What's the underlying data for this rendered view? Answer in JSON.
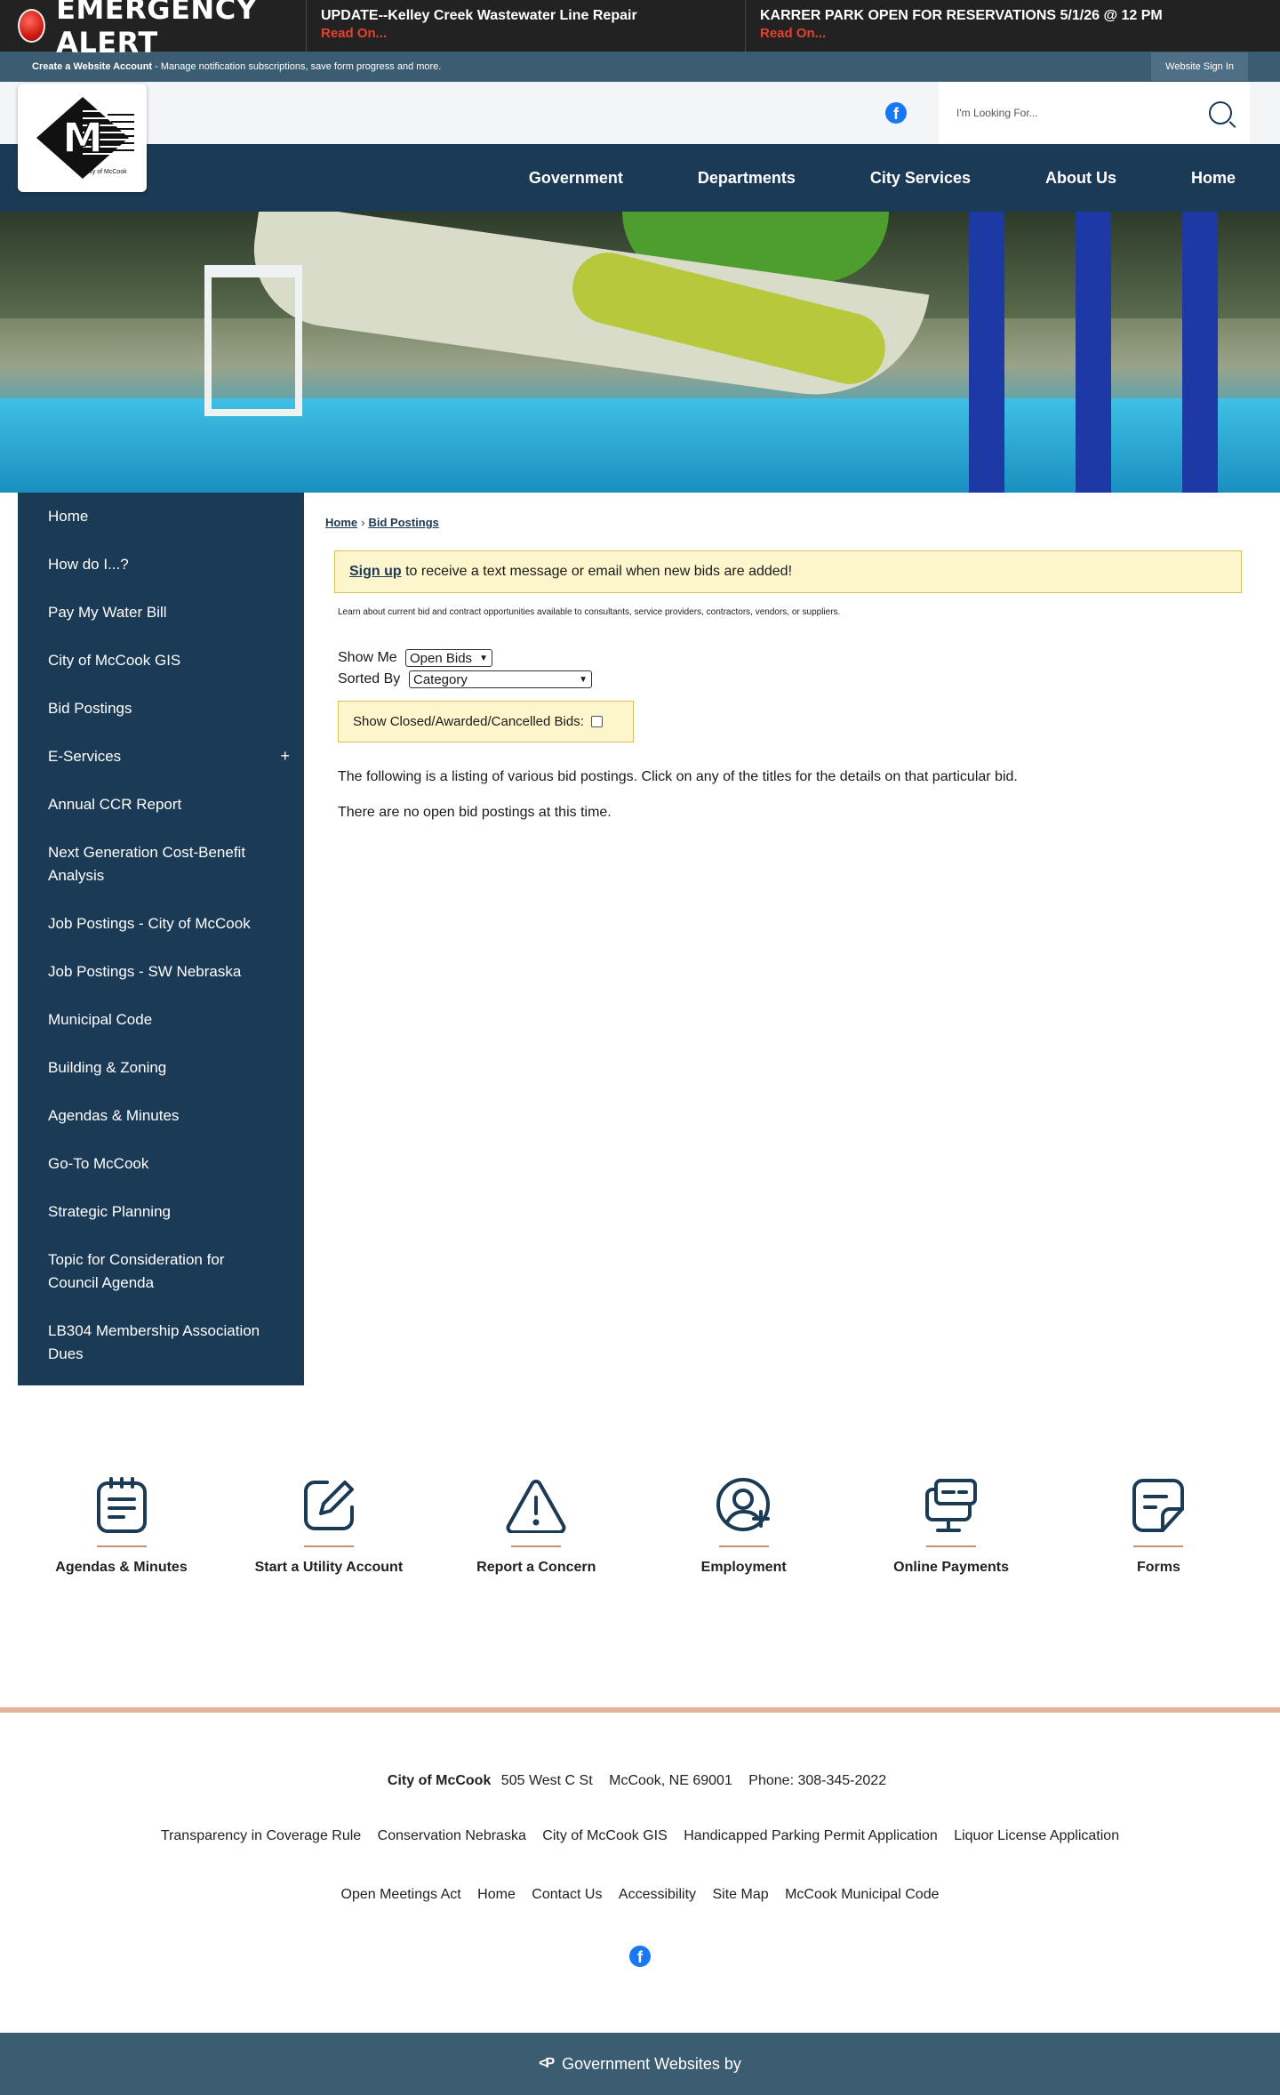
{
  "alert": {
    "title": "EMERGENCY ALERT",
    "items": [
      {
        "title": "UPDATE--Kelley Creek Wastewater Line Repair",
        "link": "Read On..."
      },
      {
        "title": "KARRER PARK OPEN FOR RESERVATIONS 5/1/26 @ 12 PM",
        "link": "Read On..."
      }
    ]
  },
  "account": {
    "create_label": "Create a Website Account",
    "description": " - Manage notification subscriptions, save form progress and more.",
    "signin_label": "Website Sign In"
  },
  "header": {
    "logo_letter": "M",
    "logo_caption": "City of McCook",
    "search_placeholder": "I'm Looking For...",
    "nav": [
      "Government",
      "Departments",
      "City Services",
      "About Us",
      "Home"
    ]
  },
  "sidebar": {
    "items": [
      "Home",
      "How do I...?",
      "Pay My Water Bill",
      "City of McCook GIS",
      "Bid Postings",
      "E-Services",
      "Annual CCR Report",
      "Next Generation Cost-Benefit Analysis",
      "Job Postings - City of McCook",
      "Job Postings - SW Nebraska",
      "Municipal Code",
      "Building & Zoning",
      "Agendas & Minutes",
      "Go-To McCook",
      "Strategic Planning",
      "Topic for Consideration for Council Agenda",
      "LB304 Membership Association Dues"
    ],
    "expand_symbol": "+"
  },
  "content": {
    "breadcrumb": {
      "home": "Home",
      "separator": "›",
      "current": "Bid Postings"
    },
    "signup_link": "Sign up",
    "signup_text": " to receive a text message or email when new bids are added!",
    "lead": "Learn about current bid and contract opportunities available to consultants, service providers, contractors, vendors, or suppliers.",
    "show_me_label": "Show Me",
    "show_me_value": "Open Bids",
    "sorted_by_label": "Sorted By",
    "sorted_by_value": "Category",
    "show_closed_label": "Show Closed/Awarded/Cancelled Bids:",
    "listing_text": "The following is a listing of various bid postings. Click on any of the titles for the details on that particular bid.",
    "empty_text": "There are no open bid postings at this time."
  },
  "quick_links": [
    {
      "label": "Agendas & Minutes",
      "icon": "notepad-icon"
    },
    {
      "label": "Start a Utility Account",
      "icon": "edit-icon"
    },
    {
      "label": "Report a Concern",
      "icon": "warning-icon"
    },
    {
      "label": "Employment",
      "icon": "user-add-icon"
    },
    {
      "label": "Online Payments",
      "icon": "monitor-payment-icon"
    },
    {
      "label": "Forms",
      "icon": "document-icon"
    }
  ],
  "footer": {
    "city": "City of McCook",
    "street": "505 West C St",
    "city_state": "McCook, NE 69001",
    "phone": "Phone: 308-345-2022",
    "links_row1": [
      "Transparency in Coverage Rule",
      "Conservation Nebraska",
      "City of McCook GIS",
      "Handicapped Parking Permit Application",
      "Liquor License Application"
    ],
    "links_row2": [
      "Open Meetings Act",
      "Home",
      "Contact Us",
      "Accessibility",
      "Site Map",
      "McCook Municipal Code"
    ],
    "bottom_text": "Government Websites by",
    "facebook_letter": "f"
  },
  "colors": {
    "navy": "#1b3a55",
    "slate": "#3c5c72",
    "alert_red": "#e5412f",
    "notice_bg": "#fdf5cc",
    "accent_tan": "#c98e73"
  }
}
